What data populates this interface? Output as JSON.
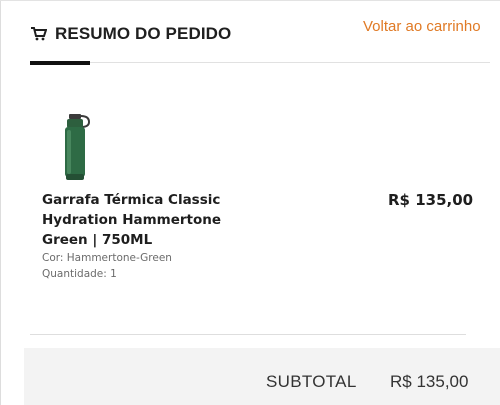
{
  "header": {
    "title": "RESUMO DO PEDIDO",
    "back_link": "Voltar ao carrinho"
  },
  "item": {
    "name_lines": [
      "Garrafa Térmica Classic",
      "Hydration Hammertone",
      "Green | 750ML"
    ],
    "color": "Cor: Hammertone-Green",
    "quantity": "Quantidade: 1",
    "price": "R$ 135,00"
  },
  "summary": {
    "subtotal_label": "SUBTOTAL",
    "subtotal_value": "R$ 135,00"
  },
  "colors": {
    "accent": "#e07a25",
    "product_green": "#2e6b45"
  },
  "icons": {
    "cart": "shopping-cart-icon"
  }
}
